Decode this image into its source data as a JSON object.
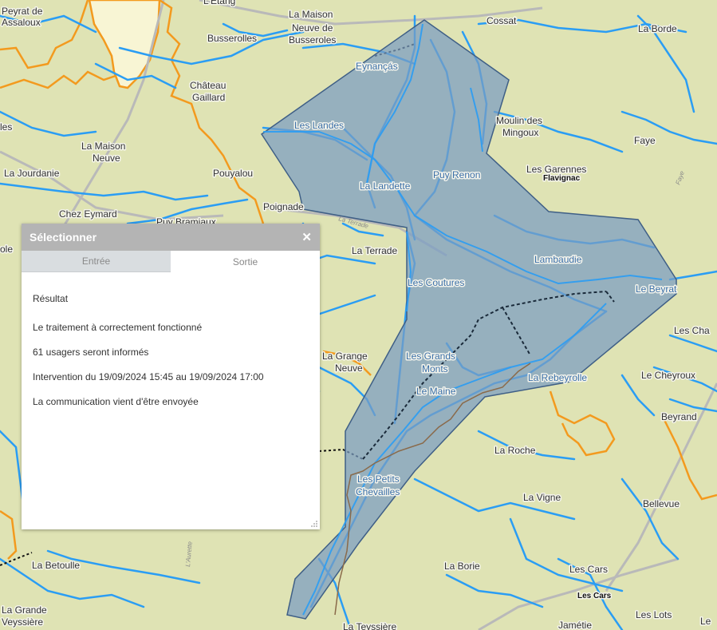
{
  "map": {
    "places": [
      {
        "id": "peyrat",
        "text": "Peyrat de"
      },
      {
        "id": "assaloux",
        "text": "Assaloux"
      },
      {
        "id": "letang",
        "text": "L'Étang"
      },
      {
        "id": "maison-neuve-busseroles-1",
        "text": "La Maison"
      },
      {
        "id": "maison-neuve-busseroles-2",
        "text": "Neuve de"
      },
      {
        "id": "maison-neuve-busseroles-3",
        "text": "Busseroles"
      },
      {
        "id": "cossat",
        "text": "Cossat"
      },
      {
        "id": "laborde",
        "text": "La Borde"
      },
      {
        "id": "busserolles",
        "text": "Busserolles"
      },
      {
        "id": "eynancas",
        "text": "Eynançás"
      },
      {
        "id": "chateau",
        "text": "Château"
      },
      {
        "id": "gaillard",
        "text": "Gaillard"
      },
      {
        "id": "moulin1",
        "text": "Moulin des"
      },
      {
        "id": "moulin2",
        "text": "Mingoux"
      },
      {
        "id": "les-landes",
        "text": "Les Landes"
      },
      {
        "id": "maison-neuve-1",
        "text": "La Maison"
      },
      {
        "id": "maison-neuve-2",
        "text": "Neuve"
      },
      {
        "id": "faye",
        "text": "Faye"
      },
      {
        "id": "jourdanie",
        "text": "La Jourdanie"
      },
      {
        "id": "pouyalou",
        "text": "Pouyalou"
      },
      {
        "id": "puy-renon",
        "text": "Puy Renon"
      },
      {
        "id": "garennes",
        "text": "Les Garennes"
      },
      {
        "id": "la-landette",
        "text": "La Landette"
      },
      {
        "id": "chez-eymard",
        "text": "Chez Eymard"
      },
      {
        "id": "poignade",
        "text": "Poignade"
      },
      {
        "id": "puy-brasniaux",
        "text": "Puy Bramiaux"
      },
      {
        "id": "la-terrade",
        "text": "La Terrade"
      },
      {
        "id": "lambaudie",
        "text": "Lambaudie"
      },
      {
        "id": "les-coutures",
        "text": "Les Coutures"
      },
      {
        "id": "le-beyrat",
        "text": "Le Beyrat"
      },
      {
        "id": "les-cha",
        "text": "Les Cha"
      },
      {
        "id": "la-grange-1",
        "text": "La Grange"
      },
      {
        "id": "la-grange-2",
        "text": "Neuve"
      },
      {
        "id": "grands-monts-1",
        "text": "Les Grands"
      },
      {
        "id": "grands-monts-2",
        "text": "Monts"
      },
      {
        "id": "rebeyrolle",
        "text": "La Rebeyrolle"
      },
      {
        "id": "cheyroux",
        "text": "Le Cheyroux"
      },
      {
        "id": "le-maine",
        "text": "Le Maine"
      },
      {
        "id": "beyrand",
        "text": "Beyrand"
      },
      {
        "id": "la-roche",
        "text": "La Roche"
      },
      {
        "id": "petits-chevailles-1",
        "text": "Les Petits"
      },
      {
        "id": "petits-chevailles-2",
        "text": "Chevailles"
      },
      {
        "id": "la-vigne",
        "text": "La Vigne"
      },
      {
        "id": "bellevue",
        "text": "Bellevue"
      },
      {
        "id": "la-betoulle",
        "text": "La Betoulle"
      },
      {
        "id": "la-borie",
        "text": "La Borie"
      },
      {
        "id": "les-cars",
        "text": "Les Cars"
      },
      {
        "id": "les-lots",
        "text": "Les Lots"
      },
      {
        "id": "la-grande-1",
        "text": "La Grande"
      },
      {
        "id": "la-grande-2",
        "text": "Veyssière"
      },
      {
        "id": "teyssiere",
        "text": "La Teyssière"
      },
      {
        "id": "jametie",
        "text": "Jamétie"
      },
      {
        "id": "le",
        "text": "Le"
      },
      {
        "id": "les",
        "text": "les"
      },
      {
        "id": "ole",
        "text": "ole"
      }
    ],
    "communes": [
      {
        "id": "flavignac",
        "text": "Flavignac"
      },
      {
        "id": "les-cars-commune",
        "text": "Les Cars"
      }
    ],
    "roads": [
      {
        "id": "road-faye",
        "text": "Faye"
      },
      {
        "id": "road-terrade",
        "text": "La Terrade"
      },
      {
        "id": "road-laurette",
        "text": "L'Aurette"
      }
    ],
    "colors": {
      "background": "#dfe3b4",
      "water": "#2a9df4",
      "boundary": "#f39a1e",
      "polygon_fill": "#7a9cc2",
      "polygon_stroke": "#3f5f86"
    }
  },
  "panel": {
    "title": "Sélectionner",
    "close_icon": "close-icon",
    "tabs": [
      {
        "label": "Entrée",
        "active": false
      },
      {
        "label": "Sortie",
        "active": true
      }
    ],
    "result_title": "Résultat",
    "lines": [
      "Le traitement à correctement fonctionné",
      "61 usagers seront informés",
      "Intervention du 19/09/2024 15:45 au 19/09/2024 17:00",
      "La communication vient d'être envoyée"
    ]
  }
}
